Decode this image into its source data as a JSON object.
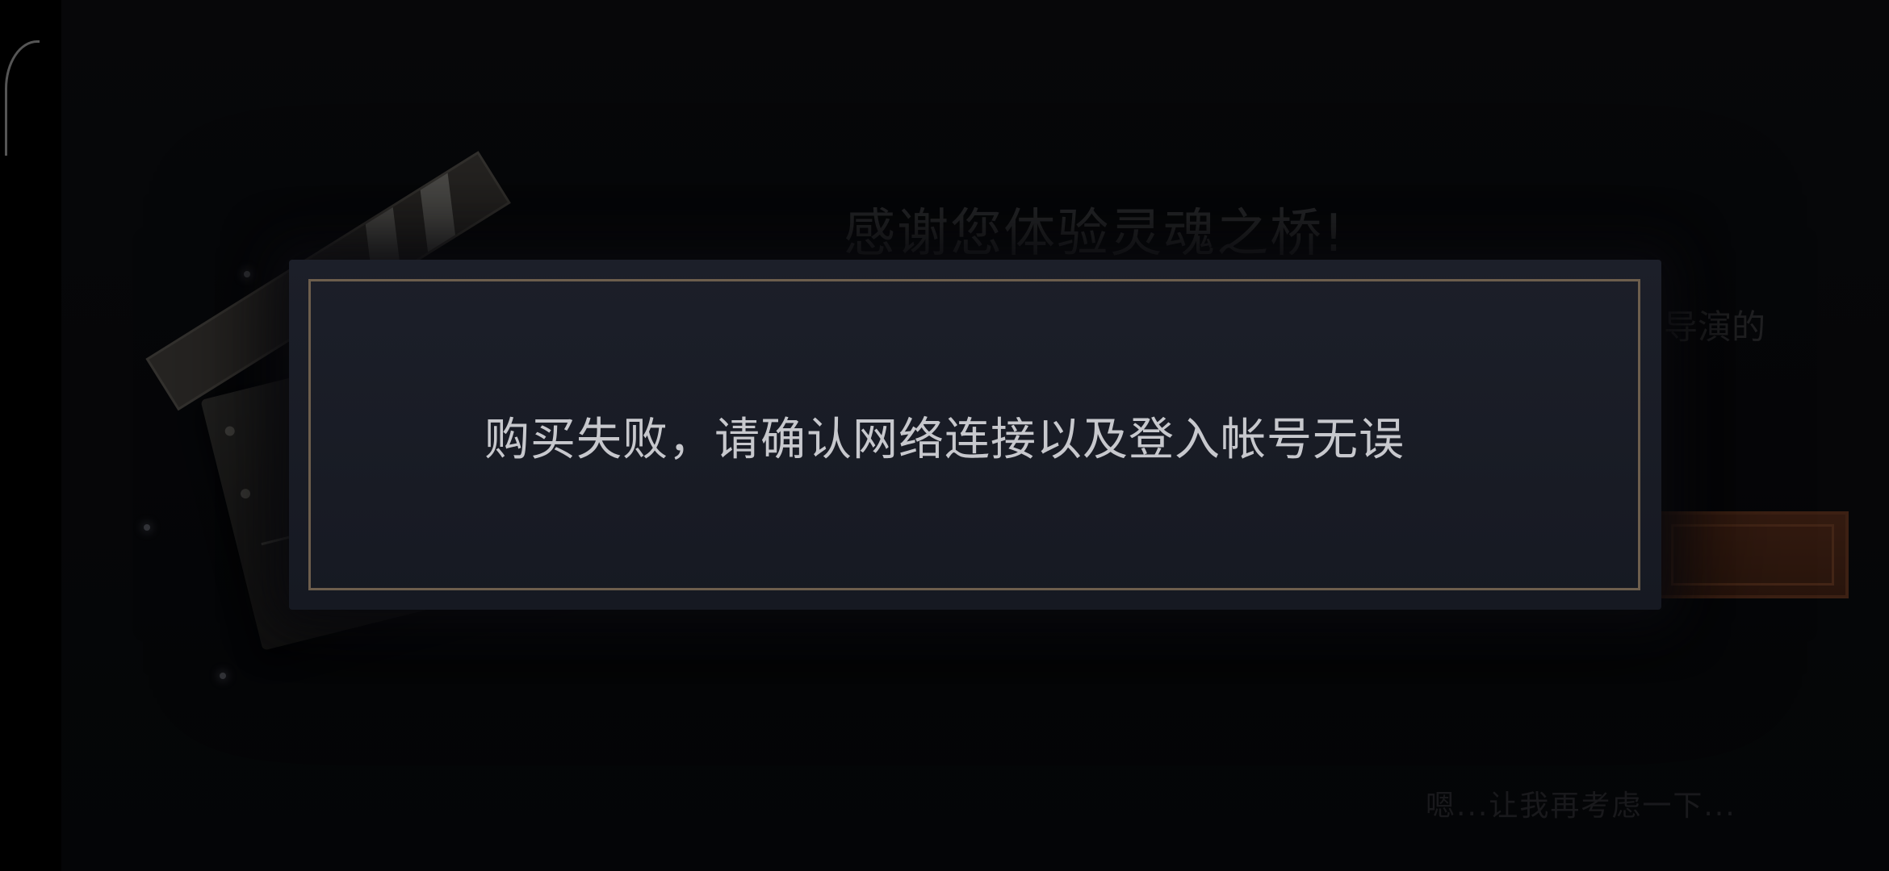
{
  "background": {
    "title": "感谢您体验灵魂之桥!",
    "partial_text": "导演的",
    "decline_text": "嗯...让我再考虑一下..."
  },
  "dialog": {
    "message": "购买失败，请确认网络连接以及登入帐号无误"
  },
  "colors": {
    "dialog_bg": "#1a1d26",
    "dialog_border": "#6d5e4d",
    "message_text": "#c7c8cd",
    "accent_button": "#5e311e"
  },
  "icons": {
    "clapperboard": "clapperboard-illustration"
  }
}
